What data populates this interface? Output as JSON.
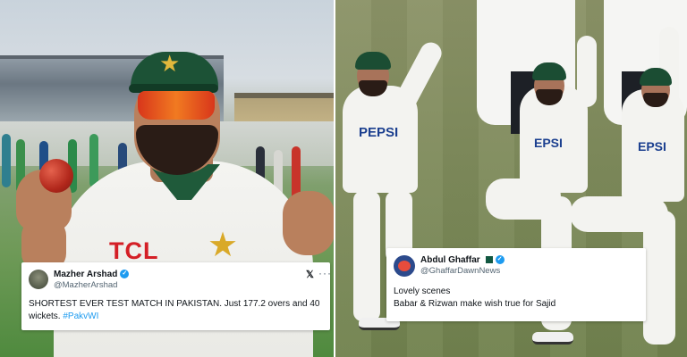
{
  "left_photo": {
    "shirt_logo": "TCL"
  },
  "right_photo": {
    "shirt_logo_1": "PEPSI",
    "shirt_logo_2": "EPSI",
    "shirt_logo_3": "EPSI"
  },
  "tweet_left": {
    "name": "Mazher Arshad",
    "handle": "@MazherArshad",
    "text": "SHORTEST EVER TEST MATCH IN PAKISTAN. Just 177.2 overs and 40 wickets.",
    "hashtag": "#PakvWI",
    "platform_icon": "x-logo-icon",
    "more_icon": "more-dots-icon",
    "verified_color": "#1d9bf0"
  },
  "tweet_right": {
    "name": "Abdul Ghaffar",
    "handle": "@GhaffarDawnNews",
    "line1": "Lovely scenes",
    "line2": "Babar & Rizwan make wish true for Sajid",
    "verified_color": "#1d9bf0"
  },
  "colors": {
    "pakistan_green": "#1c5236",
    "tcl_red": "#d41f26",
    "pepsi_blue": "#1b3f8f",
    "hashtag_blue": "#1d9bf0"
  }
}
